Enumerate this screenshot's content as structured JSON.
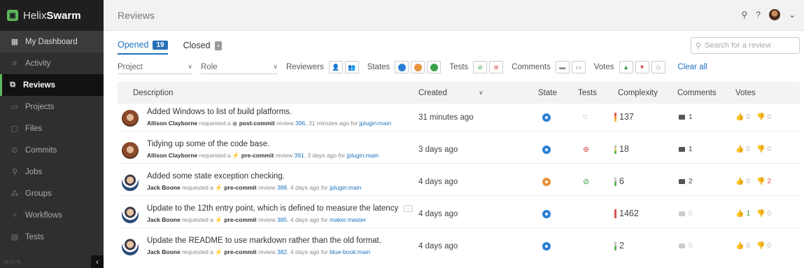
{
  "app": {
    "brand_light": "Helix",
    "brand_bold": "Swarm"
  },
  "sidebar": {
    "items": [
      {
        "label": "My Dashboard",
        "icon": "dashboard-icon"
      },
      {
        "label": "Activity",
        "icon": "activity-icon"
      },
      {
        "label": "Reviews",
        "icon": "reviews-icon",
        "active": true
      },
      {
        "label": "Projects",
        "icon": "projects-icon"
      },
      {
        "label": "Files",
        "icon": "folder-icon"
      },
      {
        "label": "Commits",
        "icon": "commit-icon"
      },
      {
        "label": "Jobs",
        "icon": "wrench-icon"
      },
      {
        "label": "Groups",
        "icon": "group-icon"
      },
      {
        "label": "Workflows",
        "icon": "workflow-icon"
      },
      {
        "label": "Tests",
        "icon": "tests-icon"
      }
    ],
    "footer_label": "MAIN",
    "collapse_label": "‹"
  },
  "header": {
    "title": "Reviews"
  },
  "tabs": [
    {
      "label": "Opened",
      "count": "19"
    },
    {
      "label": "Closed",
      "count": "▪"
    }
  ],
  "search": {
    "placeholder": "Search for a review"
  },
  "filters": {
    "project": "Project",
    "role": "Role",
    "reviewers": "Reviewers",
    "states": "States",
    "tests": "Tests",
    "comments": "Comments",
    "votes": "Votes",
    "clear_all": "Clear all"
  },
  "table": {
    "headers": {
      "description": "Description",
      "created": "Created",
      "state": "State",
      "tests": "Tests",
      "complexity": "Complexity",
      "comments": "Comments",
      "votes": "Votes"
    },
    "rows": [
      {
        "description": "Added Windows to list of build platforms.",
        "author": "Allison Clayborne",
        "requested": "requested a",
        "type": "post-commit",
        "review_word": "review",
        "review_id": "396",
        "ago": ", 31 minutes ago for",
        "branch": "jplugin:main",
        "created": "31 minutes ago",
        "complexity": "137",
        "comments": "1",
        "votes_up": "0",
        "votes_down": "0"
      },
      {
        "description": "Tidying up some of the code base.",
        "author": "Allison Clayborne",
        "requested": "requested a",
        "type": "pre-commit",
        "review_word": "review",
        "review_id": "391",
        "ago": ", 3 days ago for",
        "branch": "jplugin:main",
        "created": "3 days ago",
        "complexity": "18",
        "comments": "1",
        "votes_up": "0",
        "votes_down": "0"
      },
      {
        "description": "Added some state exception checking.",
        "author": "Jack Boone",
        "requested": "requested a",
        "type": "pre-commit",
        "review_word": "review",
        "review_id": "388",
        "ago": ", 4 days ago for",
        "branch": "jplugin:main",
        "created": "4 days ago",
        "complexity": "6",
        "comments": "2",
        "votes_up": "0",
        "votes_down": "2"
      },
      {
        "description": "Update to the 12th entry point, which is defined to measure the latency",
        "author": "Jack Boone",
        "requested": "requested a",
        "type": "pre-commit",
        "review_word": "review",
        "review_id": "385",
        "ago": ", 4 days ago for",
        "branch": "maker:master",
        "created": "4 days ago",
        "complexity": "1462",
        "comments": "0",
        "votes_up": "1",
        "votes_down": "0"
      },
      {
        "description": "Update the README to use markdown rather than the old format.",
        "author": "Jack Boone",
        "requested": "requested a",
        "type": "pre-commit",
        "review_word": "review",
        "review_id": "382",
        "ago": ", 4 days ago for",
        "branch": "blue-book:main",
        "created": "4 days ago",
        "complexity": "2",
        "comments": "0",
        "votes_up": "0",
        "votes_down": "0"
      }
    ]
  },
  "colors": {
    "accent": "#1e73be",
    "state_review": "#2a7fd4",
    "state_needs_revision": "#e8923a",
    "state_approved": "#3aa14a",
    "sidebar_bg": "#2f2f2f",
    "active_marker": "#5cb85c"
  }
}
